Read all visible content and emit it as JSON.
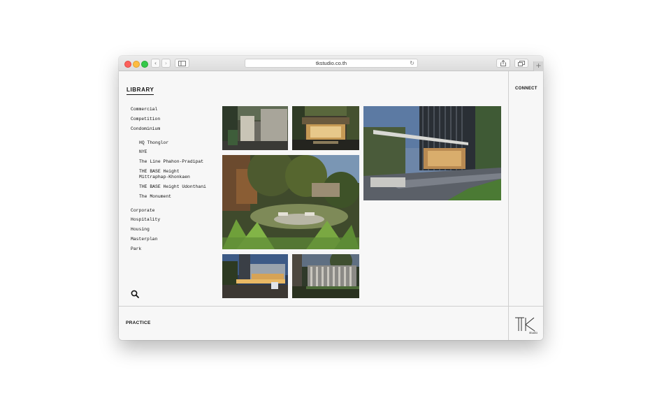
{
  "browser": {
    "url": "tkstudio.co.th"
  },
  "library": {
    "title": "LIBRARY",
    "categories_top": [
      "Commercial",
      "Competition",
      "Condominium"
    ],
    "condominium_items": [
      "HQ Thonglor",
      "NYE",
      "The Line Phahon-Pradipat",
      "THE BASE Height Mittraphap-Khonkaen",
      "THE BASE Height Udonthani",
      "The Monument"
    ],
    "categories_bottom": [
      "Corporate",
      "Hospitality",
      "Housing",
      "Masterplan",
      "Park"
    ]
  },
  "nav": {
    "connect": "CONNECT",
    "practice": "PRACTICE"
  },
  "logo": {
    "text": "TK",
    "subtext": "studio"
  },
  "icons": {
    "search": "search-icon",
    "sidebar": "sidebar-icon",
    "share": "share-icon",
    "tabs": "tabs-icon",
    "reload": "reload-icon"
  },
  "gallery": [
    "photo-walled-courtyard",
    "photo-lit-lobby-entrance",
    "photo-tower-garden-plaza",
    "photo-tropical-garden",
    "photo-night-drop-off",
    "photo-night-screen-wall"
  ]
}
